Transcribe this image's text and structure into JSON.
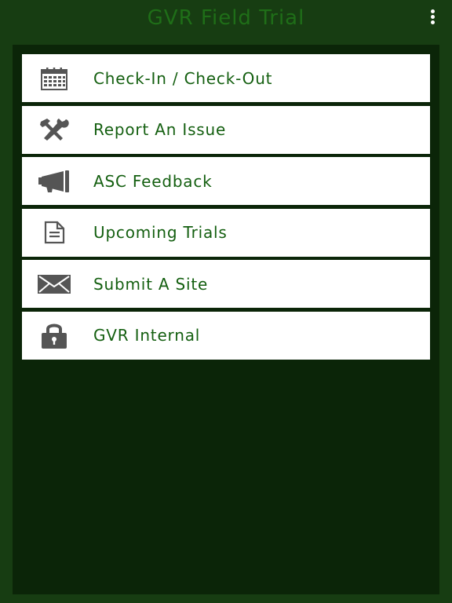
{
  "header": {
    "title": "GVR Field Trial",
    "overflow_icon": "more-vert-icon"
  },
  "colors": {
    "background": "#173d12",
    "panel": "#0b2508",
    "title": "#1f6e18",
    "label": "#145f10",
    "icon": "#555555",
    "item_background": "#ffffff"
  },
  "menu": {
    "items": [
      {
        "label": "Check-In / Check-Out",
        "icon": "calendar-icon"
      },
      {
        "label": "Report An Issue",
        "icon": "tools-icon"
      },
      {
        "label": "ASC Feedback",
        "icon": "megaphone-icon"
      },
      {
        "label": "Upcoming Trials",
        "icon": "document-icon"
      },
      {
        "label": "Submit A Site",
        "icon": "envelope-icon"
      },
      {
        "label": "GVR Internal",
        "icon": "lock-icon"
      }
    ]
  }
}
